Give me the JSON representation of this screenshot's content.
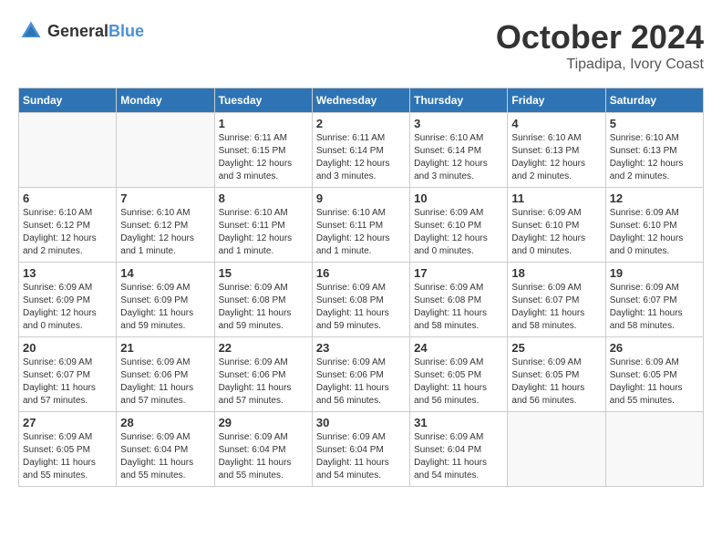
{
  "header": {
    "logo_general": "General",
    "logo_blue": "Blue",
    "month": "October 2024",
    "location": "Tipadipa, Ivory Coast"
  },
  "weekdays": [
    "Sunday",
    "Monday",
    "Tuesday",
    "Wednesday",
    "Thursday",
    "Friday",
    "Saturday"
  ],
  "weeks": [
    [
      {
        "day": "",
        "info": ""
      },
      {
        "day": "",
        "info": ""
      },
      {
        "day": "1",
        "info": "Sunrise: 6:11 AM\nSunset: 6:15 PM\nDaylight: 12 hours and 3 minutes."
      },
      {
        "day": "2",
        "info": "Sunrise: 6:11 AM\nSunset: 6:14 PM\nDaylight: 12 hours and 3 minutes."
      },
      {
        "day": "3",
        "info": "Sunrise: 6:10 AM\nSunset: 6:14 PM\nDaylight: 12 hours and 3 minutes."
      },
      {
        "day": "4",
        "info": "Sunrise: 6:10 AM\nSunset: 6:13 PM\nDaylight: 12 hours and 2 minutes."
      },
      {
        "day": "5",
        "info": "Sunrise: 6:10 AM\nSunset: 6:13 PM\nDaylight: 12 hours and 2 minutes."
      }
    ],
    [
      {
        "day": "6",
        "info": "Sunrise: 6:10 AM\nSunset: 6:12 PM\nDaylight: 12 hours and 2 minutes."
      },
      {
        "day": "7",
        "info": "Sunrise: 6:10 AM\nSunset: 6:12 PM\nDaylight: 12 hours and 1 minute."
      },
      {
        "day": "8",
        "info": "Sunrise: 6:10 AM\nSunset: 6:11 PM\nDaylight: 12 hours and 1 minute."
      },
      {
        "day": "9",
        "info": "Sunrise: 6:10 AM\nSunset: 6:11 PM\nDaylight: 12 hours and 1 minute."
      },
      {
        "day": "10",
        "info": "Sunrise: 6:09 AM\nSunset: 6:10 PM\nDaylight: 12 hours and 0 minutes."
      },
      {
        "day": "11",
        "info": "Sunrise: 6:09 AM\nSunset: 6:10 PM\nDaylight: 12 hours and 0 minutes."
      },
      {
        "day": "12",
        "info": "Sunrise: 6:09 AM\nSunset: 6:10 PM\nDaylight: 12 hours and 0 minutes."
      }
    ],
    [
      {
        "day": "13",
        "info": "Sunrise: 6:09 AM\nSunset: 6:09 PM\nDaylight: 12 hours and 0 minutes."
      },
      {
        "day": "14",
        "info": "Sunrise: 6:09 AM\nSunset: 6:09 PM\nDaylight: 11 hours and 59 minutes."
      },
      {
        "day": "15",
        "info": "Sunrise: 6:09 AM\nSunset: 6:08 PM\nDaylight: 11 hours and 59 minutes."
      },
      {
        "day": "16",
        "info": "Sunrise: 6:09 AM\nSunset: 6:08 PM\nDaylight: 11 hours and 59 minutes."
      },
      {
        "day": "17",
        "info": "Sunrise: 6:09 AM\nSunset: 6:08 PM\nDaylight: 11 hours and 58 minutes."
      },
      {
        "day": "18",
        "info": "Sunrise: 6:09 AM\nSunset: 6:07 PM\nDaylight: 11 hours and 58 minutes."
      },
      {
        "day": "19",
        "info": "Sunrise: 6:09 AM\nSunset: 6:07 PM\nDaylight: 11 hours and 58 minutes."
      }
    ],
    [
      {
        "day": "20",
        "info": "Sunrise: 6:09 AM\nSunset: 6:07 PM\nDaylight: 11 hours and 57 minutes."
      },
      {
        "day": "21",
        "info": "Sunrise: 6:09 AM\nSunset: 6:06 PM\nDaylight: 11 hours and 57 minutes."
      },
      {
        "day": "22",
        "info": "Sunrise: 6:09 AM\nSunset: 6:06 PM\nDaylight: 11 hours and 57 minutes."
      },
      {
        "day": "23",
        "info": "Sunrise: 6:09 AM\nSunset: 6:06 PM\nDaylight: 11 hours and 56 minutes."
      },
      {
        "day": "24",
        "info": "Sunrise: 6:09 AM\nSunset: 6:05 PM\nDaylight: 11 hours and 56 minutes."
      },
      {
        "day": "25",
        "info": "Sunrise: 6:09 AM\nSunset: 6:05 PM\nDaylight: 11 hours and 56 minutes."
      },
      {
        "day": "26",
        "info": "Sunrise: 6:09 AM\nSunset: 6:05 PM\nDaylight: 11 hours and 55 minutes."
      }
    ],
    [
      {
        "day": "27",
        "info": "Sunrise: 6:09 AM\nSunset: 6:05 PM\nDaylight: 11 hours and 55 minutes."
      },
      {
        "day": "28",
        "info": "Sunrise: 6:09 AM\nSunset: 6:04 PM\nDaylight: 11 hours and 55 minutes."
      },
      {
        "day": "29",
        "info": "Sunrise: 6:09 AM\nSunset: 6:04 PM\nDaylight: 11 hours and 55 minutes."
      },
      {
        "day": "30",
        "info": "Sunrise: 6:09 AM\nSunset: 6:04 PM\nDaylight: 11 hours and 54 minutes."
      },
      {
        "day": "31",
        "info": "Sunrise: 6:09 AM\nSunset: 6:04 PM\nDaylight: 11 hours and 54 minutes."
      },
      {
        "day": "",
        "info": ""
      },
      {
        "day": "",
        "info": ""
      }
    ]
  ]
}
